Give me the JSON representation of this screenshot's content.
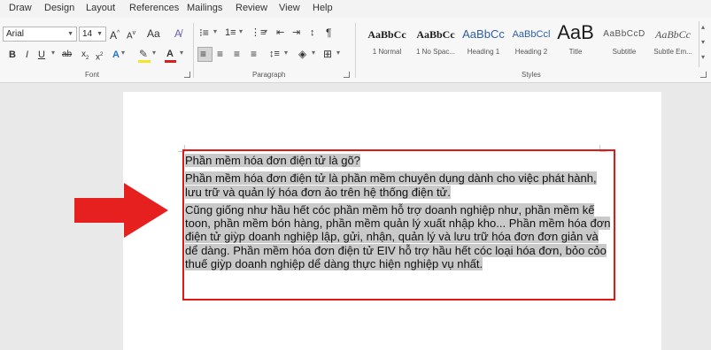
{
  "menu": {
    "tabs": [
      "Draw",
      "Design",
      "Layout",
      "References",
      "Mailings",
      "Review",
      "View",
      "Help"
    ]
  },
  "ribbon": {
    "font": {
      "family": "Arial",
      "size": "14",
      "group_label": "Font"
    },
    "paragraph": {
      "group_label": "Paragraph"
    },
    "styles": {
      "group_label": "Styles",
      "items": [
        {
          "sample": "AaBbCc",
          "name": "1 Normal"
        },
        {
          "sample": "AaBbCc",
          "name": "1 No Spac..."
        },
        {
          "sample": "AaBbCc",
          "name": "Heading 1"
        },
        {
          "sample": "AaBbCcl",
          "name": "Heading 2"
        },
        {
          "sample": "AaB",
          "name": "Title"
        },
        {
          "sample": "AaBbCcD",
          "name": "Subtitle"
        },
        {
          "sample": "AaBbCc",
          "name": "Subtle Em..."
        }
      ]
    }
  },
  "document": {
    "paragraphs": [
      "Phần mềm hóa đơn điện tử là gõ?",
      "Phần mềm hóa đơn điện tử là phần mềm chuyên dụng dành cho việc phát hành, lưu trữ và quản lý hóa đơn ảo trên hệ thống điện tử.",
      "Cũng giống như hầu hết cóc phần mềm hỗ trợ doanh nghiệp như, phần mềm kế toon, phần mềm bón hàng, phần mềm quản lý xuất nhập kho... Phần mềm hóa đơn điện tử giỳp doanh nghiệp lập, gửi, nhận, quản lý và lưu trữ hóa đơn đơn giản và dể dàng. Phần mềm hóa đơn điện tử EIV hỗ trợ hầu hết cóc loại hóa đơn, bỏo cỏo thuế giỳp doanh nghiệp dể dàng thực hiện nghiệp vụ nhất."
    ]
  },
  "colors": {
    "arrow": "#e61f1f",
    "box": "#e01818",
    "selection": "#c9c9c9",
    "highlight_swatch": "#f5e42a",
    "font_color_swatch": "#d62020"
  }
}
